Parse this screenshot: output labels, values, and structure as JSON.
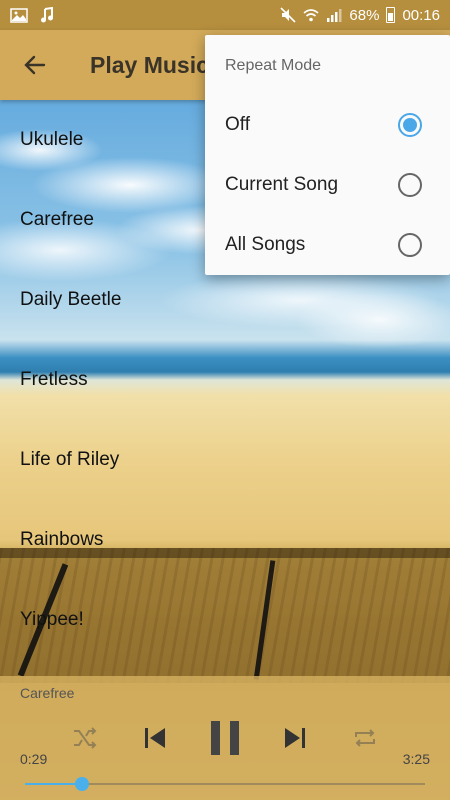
{
  "status_bar": {
    "battery_percent": "68%",
    "time": "00:16",
    "left_icons": [
      "gallery-icon",
      "music-note-icon"
    ],
    "right_icons": [
      "mute-icon",
      "wifi-icon",
      "signal-icon",
      "battery-icon"
    ]
  },
  "app_bar": {
    "title": "Play Music",
    "back_icon": "arrow-left-icon"
  },
  "songs": [
    "Ukulele",
    "Carefree",
    "Daily Beetle",
    "Fretless",
    "Life of Riley",
    "Rainbows",
    "Yippee!"
  ],
  "repeat_menu": {
    "title": "Repeat Mode",
    "options": [
      {
        "label": "Off",
        "selected": true
      },
      {
        "label": "Current Song",
        "selected": false
      },
      {
        "label": "All Songs",
        "selected": false
      }
    ],
    "accent_color": "#4aa8e8"
  },
  "player": {
    "now_playing": "Carefree",
    "elapsed": "0:29",
    "duration": "3:25",
    "progress_fraction": 0.1415,
    "controls": [
      "shuffle-icon",
      "previous-icon",
      "pause-icon",
      "next-icon",
      "repeat-icon"
    ]
  }
}
